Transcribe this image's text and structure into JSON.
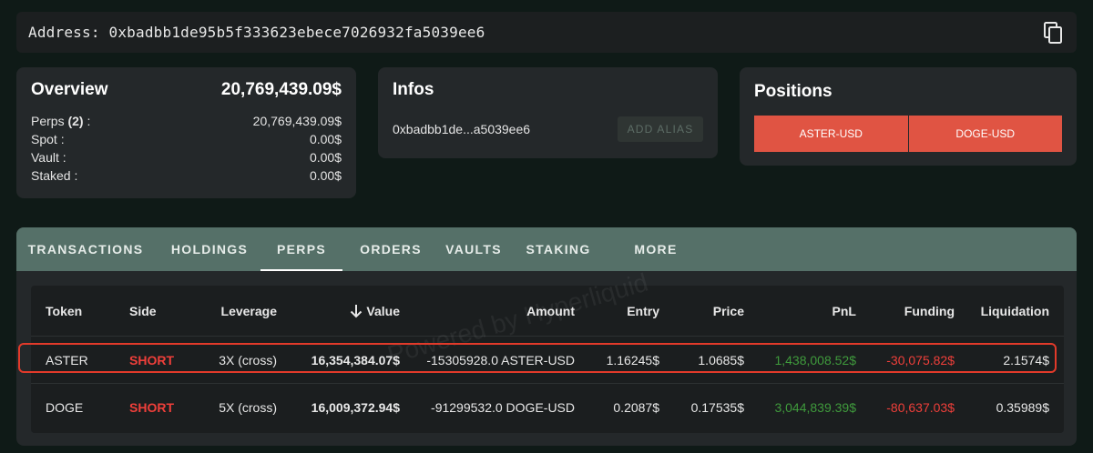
{
  "address_bar": {
    "text": "Address: 0xbadbb1de95b5f333623ebece7026932fa5039ee6",
    "copy_icon": "copy-icon"
  },
  "overview": {
    "title": "Overview",
    "total": "20,769,439.09$",
    "rows": [
      {
        "label": "Perps (2) :",
        "value": "20,769,439.09$"
      },
      {
        "label": "Spot :",
        "value": "0.00$"
      },
      {
        "label": "Vault :",
        "value": "0.00$"
      },
      {
        "label": "Staked :",
        "value": "0.00$"
      }
    ]
  },
  "infos": {
    "title": "Infos",
    "short_address": "0xbadbb1de...a5039ee6",
    "alias_button": "ADD ALIAS"
  },
  "positions": {
    "title": "Positions",
    "buttons": [
      "ASTER-USD",
      "DOGE-USD"
    ]
  },
  "tabs": [
    "TRANSACTIONS",
    "HOLDINGS",
    "PERPS",
    "ORDERS",
    "VAULTS",
    "STAKING",
    "MORE"
  ],
  "active_tab": "PERPS",
  "table": {
    "headers": {
      "token": "Token",
      "side": "Side",
      "leverage": "Leverage",
      "value": "Value",
      "amount": "Amount",
      "entry": "Entry",
      "price": "Price",
      "pnl": "PnL",
      "funding": "Funding",
      "liquidation": "Liquidation"
    },
    "sort_icon": "arrow-down-icon",
    "rows": [
      {
        "token": "ASTER",
        "side": "SHORT",
        "leverage": "3X (cross)",
        "value": "16,354,384.07$",
        "amount": "-15305928.0 ASTER-USD",
        "entry": "1.16245$",
        "price": "1.0685$",
        "pnl": "1,438,008.52$",
        "funding": "-30,075.82$",
        "liquidation": "2.1574$"
      },
      {
        "token": "DOGE",
        "side": "SHORT",
        "leverage": "5X (cross)",
        "value": "16,009,372.94$",
        "amount": "-91299532.0 DOGE-USD",
        "entry": "0.2087$",
        "price": "0.17535$",
        "pnl": "3,044,839.39$",
        "funding": "-80,637.03$",
        "liquidation": "0.35989$"
      }
    ]
  },
  "watermark": "Powered by Hyperliquid",
  "colors": {
    "accent_tab_bar": "#557068",
    "position_button": "#e05443",
    "short": "#ef3f3a",
    "pnl_positive": "#3f9a3c",
    "highlight_border": "#e23a2a"
  }
}
